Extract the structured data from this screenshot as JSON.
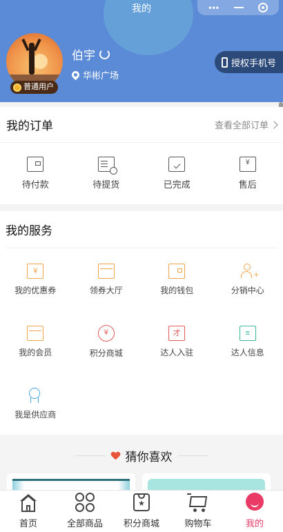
{
  "app": {
    "title": "我的"
  },
  "profile": {
    "username": "伯宇",
    "member_level": "普通用户",
    "location": "华彬广场",
    "auth_button": "授权手机号"
  },
  "orders": {
    "title": "我的订单",
    "view_all": "查看全部订单",
    "items": [
      {
        "label": "待付款",
        "icon": "wallet-icon"
      },
      {
        "label": "待提货",
        "icon": "document-clock-icon"
      },
      {
        "label": "已完成",
        "icon": "box-check-icon"
      },
      {
        "label": "售后",
        "icon": "yen-return-icon"
      }
    ]
  },
  "services": {
    "title": "我的服务",
    "items": [
      {
        "label": "我的优惠券",
        "icon": "coupon-icon"
      },
      {
        "label": "领券大厅",
        "icon": "card-icon"
      },
      {
        "label": "我的钱包",
        "icon": "wallet-icon"
      },
      {
        "label": "分销中心",
        "icon": "user-add-icon"
      },
      {
        "label": "我的会员",
        "icon": "member-card-icon"
      },
      {
        "label": "积分商城",
        "icon": "yen-circle-icon"
      },
      {
        "label": "达人入驻",
        "icon": "talent-icon"
      },
      {
        "label": "达人信息",
        "icon": "id-card-icon"
      },
      {
        "label": "我是供应商",
        "icon": "medal-icon"
      }
    ]
  },
  "guess": {
    "title": "猜你喜欢"
  },
  "tabbar": {
    "items": [
      {
        "label": "首页",
        "icon": "home-icon"
      },
      {
        "label": "全部商品",
        "icon": "grid-icon"
      },
      {
        "label": "积分商城",
        "icon": "bag-star-icon"
      },
      {
        "label": "购物车",
        "icon": "cart-icon"
      },
      {
        "label": "我的",
        "icon": "profile-icon",
        "active": true
      }
    ]
  },
  "colors": {
    "header_bg": "#5b8bd7",
    "accent": "#e93b66",
    "service_orange": "#f0a54a",
    "service_red": "#e35a5a",
    "service_teal": "#3bb6a0",
    "service_blue": "#4aa8e0"
  }
}
